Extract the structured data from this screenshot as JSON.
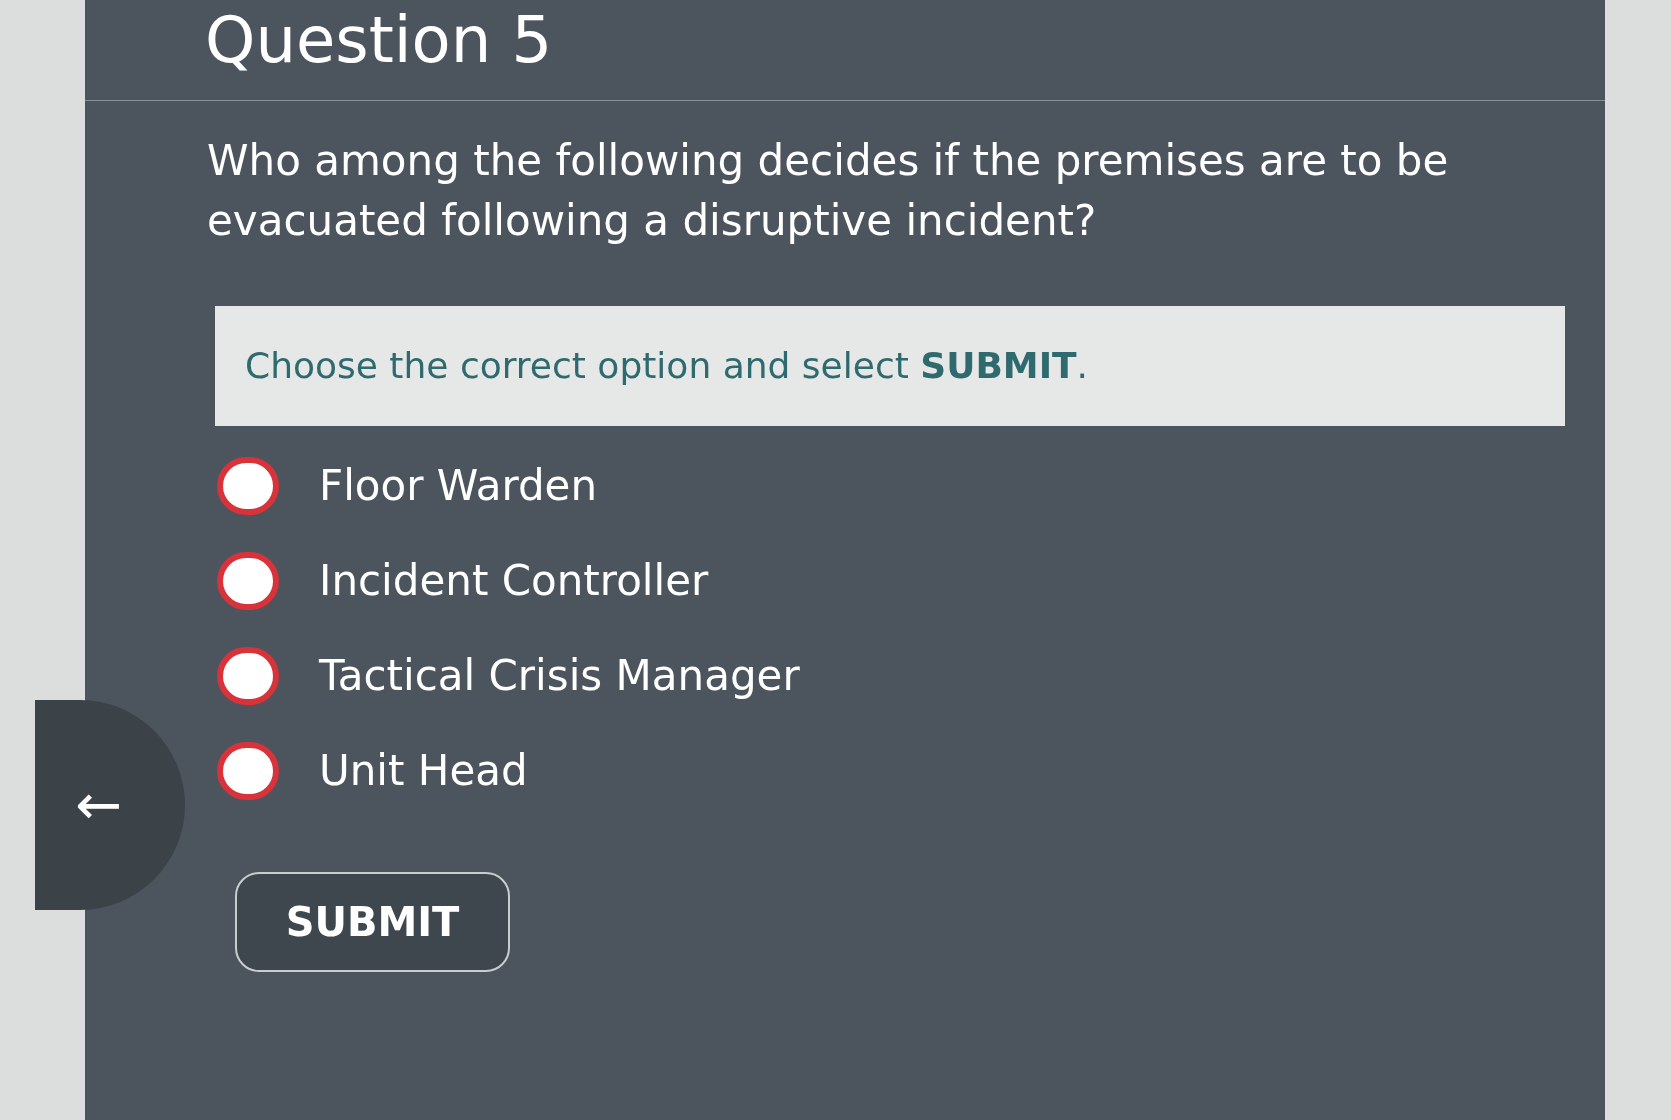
{
  "title": "Question 5",
  "question": "Who among the following decides if the premises are to be evacuated following a disruptive incident?",
  "instruction": "Choose the correct option and select **SUBMIT**.",
  "back_button": "←",
  "options": [
    {
      "label": "Floor Warden",
      "selected": false
    },
    {
      "label": "Incident Controller",
      "selected": false
    },
    {
      "label": "Tactical Crisis Manager",
      "selected": false
    },
    {
      "label": "Unit Head",
      "selected": false
    }
  ],
  "submit_button": "SUBMIT"
}
